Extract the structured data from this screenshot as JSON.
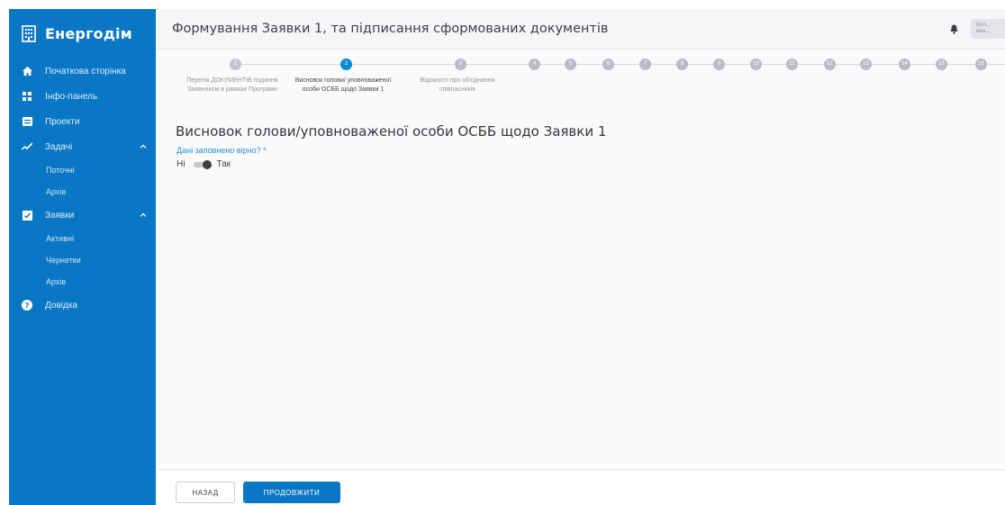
{
  "sidebar": {
    "brand_title": "Енергодім",
    "brand_icon": "building-icon",
    "items": [
      {
        "label": "Початкова сторінка",
        "icon": "home-icon"
      },
      {
        "label": "Інфо-панель",
        "icon": "dashboard-icon"
      },
      {
        "label": "Проекти",
        "icon": "projects-icon"
      },
      {
        "label": "Задачі",
        "icon": "tasks-icon",
        "expanded": true,
        "children": [
          "Поточні",
          "Архів"
        ]
      },
      {
        "label": "Заявки",
        "icon": "applications-icon",
        "expanded": true,
        "children": [
          "Активні",
          "Чернетки",
          "Архів"
        ]
      },
      {
        "label": "Довідка",
        "icon": "help-icon"
      }
    ]
  },
  "header": {
    "title": "Формування Заявки 1, та підписання сформованих документів",
    "user_line1": "Вол...",
    "user_line2": "кінч..."
  },
  "stepper": {
    "steps": [
      {
        "number": "1",
        "label": "Перелік ДОКУМЕНТІВ подання Заявником в рамках Програми",
        "state": "done"
      },
      {
        "number": "2",
        "label": "Висновок голови/ уповноваженої особи ОСББ щодо Заявки 1",
        "state": "active"
      },
      {
        "number": "3",
        "label": "Відомості про об'єднання співласників",
        "state": "pending"
      },
      {
        "number": "4",
        "state": "pending"
      },
      {
        "number": "5",
        "state": "pending"
      },
      {
        "number": "6",
        "state": "pending"
      },
      {
        "number": "7",
        "state": "pending"
      },
      {
        "number": "8",
        "state": "pending"
      },
      {
        "number": "9",
        "state": "pending"
      },
      {
        "number": "10",
        "state": "pending"
      },
      {
        "number": "11",
        "state": "pending"
      },
      {
        "number": "12",
        "state": "pending"
      },
      {
        "number": "13",
        "state": "pending"
      },
      {
        "number": "14",
        "state": "pending"
      },
      {
        "number": "15",
        "state": "pending"
      },
      {
        "number": "16",
        "state": "pending"
      }
    ]
  },
  "main": {
    "section_title": "Висновок голови/уповноваженої особи ОСББ щодо Заявки 1",
    "field_label": "Дані заповнено вірно? *",
    "toggle_off_label": "Ні",
    "toggle_on_label": "Так"
  },
  "footer": {
    "back_label": "НАЗАД",
    "next_label": "ПРОДОВЖИТИ"
  },
  "colors": {
    "sidebar": "#0a77c4",
    "accent": "#0a89d8",
    "link": "#2b8ed6"
  }
}
